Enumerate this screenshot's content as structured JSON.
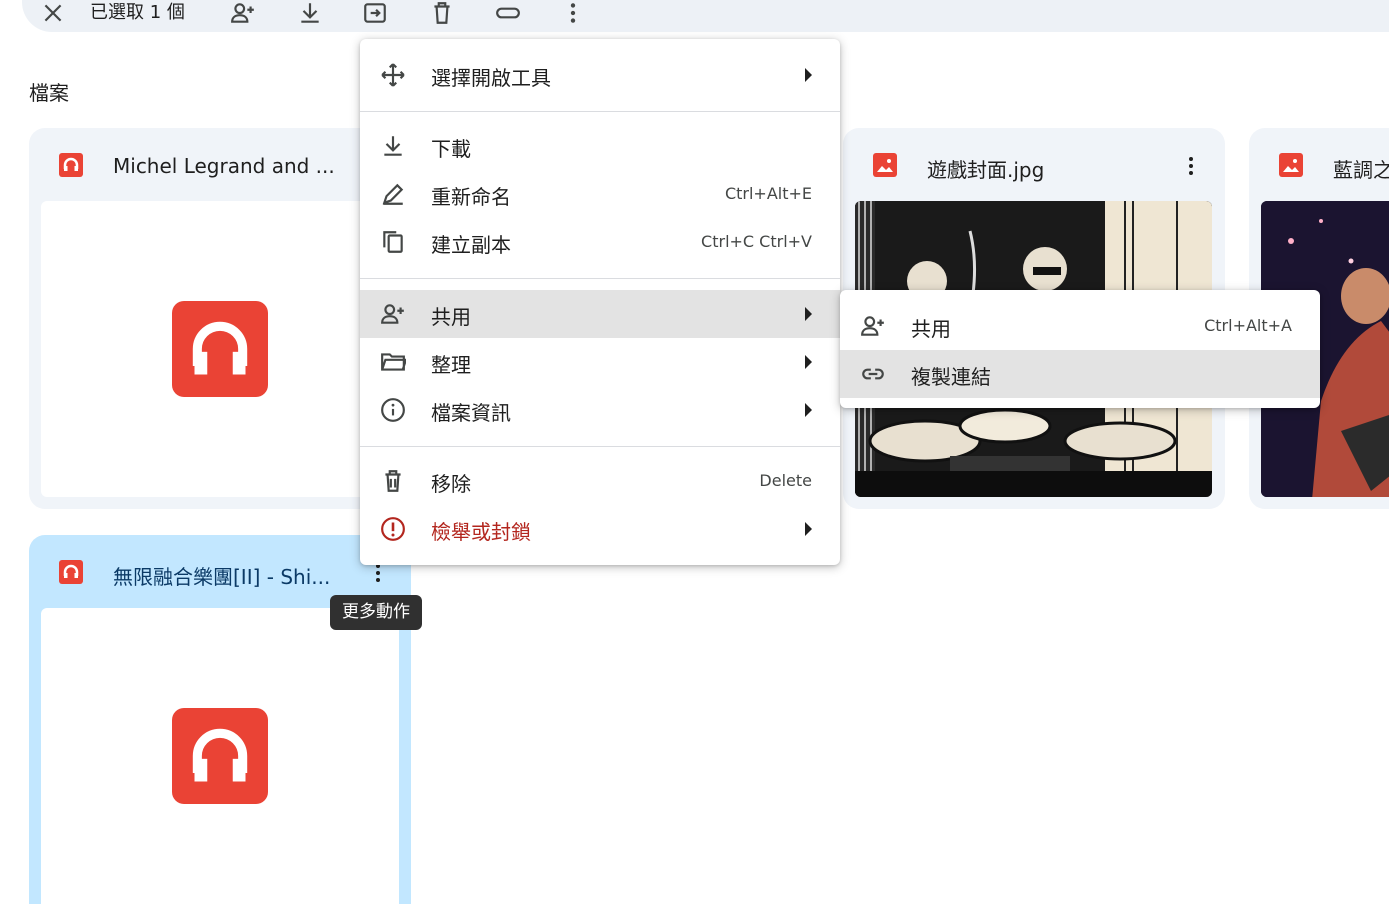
{
  "selection_bar": {
    "count_label": "已選取 1 個"
  },
  "section": {
    "title": "檔案"
  },
  "cards": [
    {
      "title": "Michel Legrand and ...",
      "type": "audio"
    },
    {
      "title": "遊戲封面.jpg",
      "type": "image"
    },
    {
      "title": "藍調之",
      "type": "image"
    },
    {
      "title": "無限融合樂團[II] - Shi...",
      "type": "audio",
      "selected": true
    }
  ],
  "tooltip": "更多動作",
  "menu": {
    "items": [
      {
        "label": "選擇開啟工具",
        "icon": "open-with-icon",
        "arrow": true
      },
      {
        "label": "下載",
        "icon": "download-icon"
      },
      {
        "label": "重新命名",
        "icon": "rename-icon",
        "shortcut": "Ctrl+Alt+E"
      },
      {
        "label": "建立副本",
        "icon": "copy-icon",
        "shortcut": "Ctrl+C Ctrl+V"
      },
      {
        "label": "共用",
        "icon": "share-person-icon",
        "arrow": true,
        "highlighted": true
      },
      {
        "label": "整理",
        "icon": "folder-icon",
        "arrow": true
      },
      {
        "label": "檔案資訊",
        "icon": "info-icon",
        "arrow": true
      },
      {
        "label": "移除",
        "icon": "trash-icon",
        "shortcut": "Delete"
      },
      {
        "label": "檢舉或封鎖",
        "icon": "report-icon",
        "arrow": true,
        "danger": true
      }
    ]
  },
  "submenu": {
    "items": [
      {
        "label": "共用",
        "icon": "share-person-icon",
        "shortcut": "Ctrl+Alt+A"
      },
      {
        "label": "複製連結",
        "icon": "link-icon",
        "highlighted": true
      }
    ]
  },
  "colors": {
    "accent_red": "#ea4335",
    "selected_card": "#c2e7ff",
    "card_bg": "#f0f4f9",
    "danger": "#b3261e"
  }
}
